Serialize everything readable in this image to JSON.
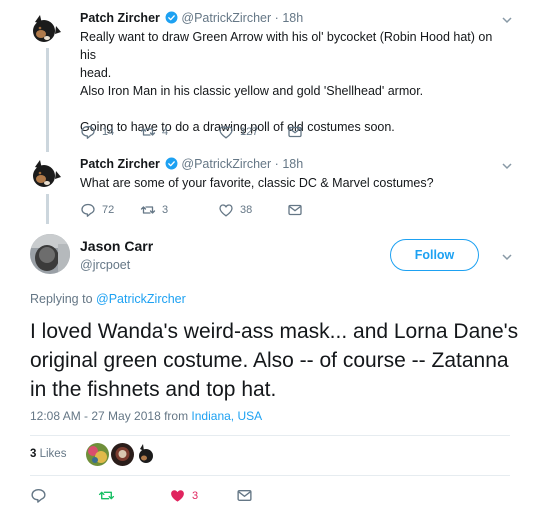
{
  "tweets": [
    {
      "name": "Patch Zircher",
      "handle": "@PatrickZircher",
      "time": "18h",
      "lines": [
        "Really want to draw Green Arrow with his ol' bycocket (Robin Hood hat) on his",
        "head.",
        "Also Iron Man in his classic yellow and gold 'Shellhead' armor.",
        "",
        "Going to have to do a drawing poll of old costumes soon."
      ],
      "replies": "14",
      "retweets": "4",
      "likes": "127"
    },
    {
      "name": "Patch Zircher",
      "handle": "@PatrickZircher",
      "time": "18h",
      "lines": [
        "What are some of your favorite, classic DC & Marvel costumes?"
      ],
      "replies": "72",
      "retweets": "3",
      "likes": "38"
    }
  ],
  "main": {
    "name": "Jason Carr",
    "handle": "@jrcpoet",
    "follow_label": "Follow",
    "replying_prefix": "Replying to ",
    "replying_to": "@PatrickZircher",
    "text": "I loved Wanda's weird-ass mask... and Lorna Dane's original green costume. Also -- of course -- Zatanna in the fishnets and top hat.",
    "timestamp": "12:08 AM - 27 May 2018 from ",
    "location": "Indiana, USA",
    "likes_count": "3",
    "likes_label": "Likes",
    "action_likes": "3"
  },
  "colors": {
    "accent": "#1da1f2",
    "like_red": "#e0245e",
    "muted": "#657786"
  }
}
